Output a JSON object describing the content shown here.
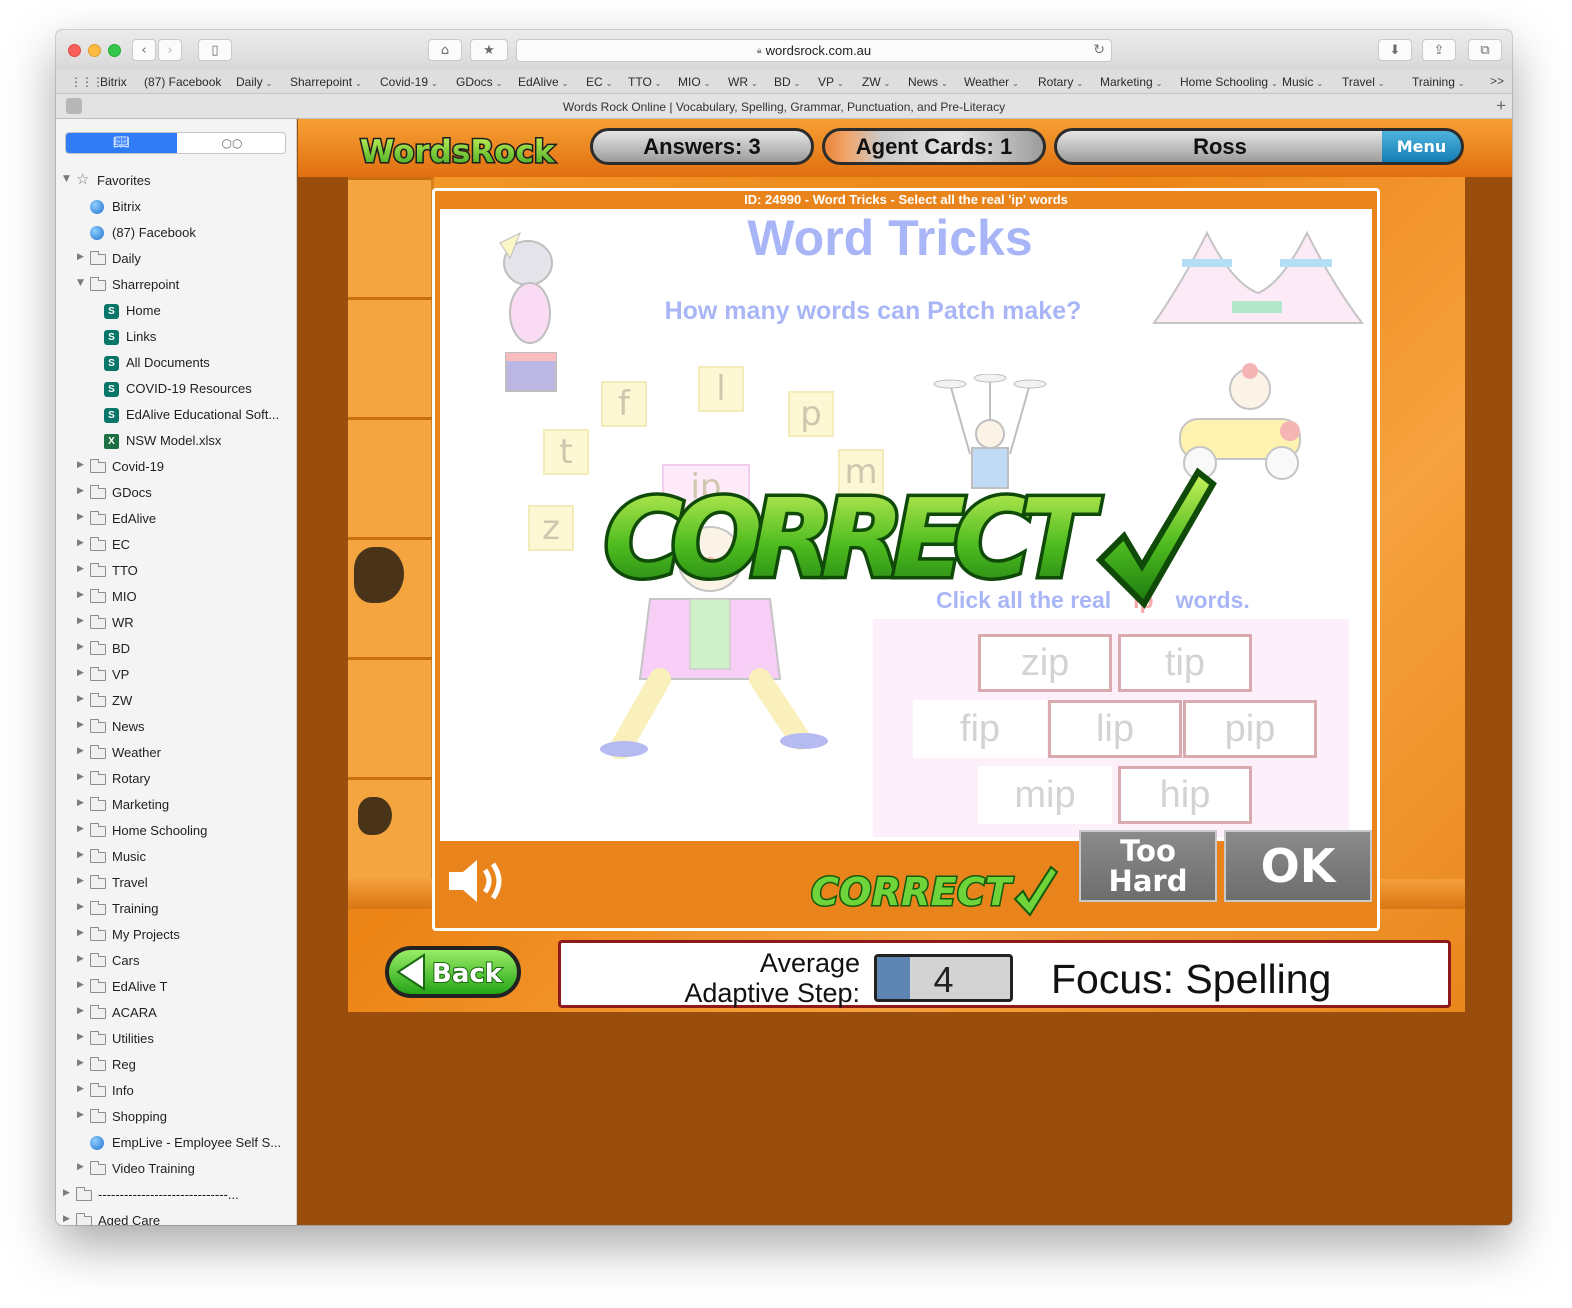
{
  "browser": {
    "url": "wordsrock.com.au",
    "tab_title": "Words Rock Online | Vocabulary, Spelling, Grammar, Punctuation, and Pre-Literacy",
    "favorites_bar": [
      "Bitrix",
      "(87) Facebook",
      "Daily",
      "Sharrepoint",
      "Covid-19",
      "GDocs",
      "EdAlive",
      "EC",
      "TTO",
      "MIO",
      "WR",
      "BD",
      "VP",
      "ZW",
      "News",
      "Weather",
      "Rotary",
      "Marketing",
      "Home Schooling",
      "Music",
      "Travel",
      "Training"
    ],
    "favorites_more": ">>"
  },
  "sidebar": {
    "header": "Favorites",
    "items": [
      {
        "label": "Bitrix",
        "icon": "globe-icon",
        "level": 1
      },
      {
        "label": "(87) Facebook",
        "icon": "globe-icon",
        "level": 1
      },
      {
        "label": "Daily",
        "icon": "folder-icon",
        "level": 1,
        "collapsed": true
      },
      {
        "label": "Sharrepoint",
        "icon": "folder-icon",
        "level": 1,
        "expanded": true
      },
      {
        "label": "Home",
        "icon": "sharepoint-icon",
        "level": 2
      },
      {
        "label": "Links",
        "icon": "sharepoint-icon",
        "level": 2
      },
      {
        "label": "All Documents",
        "icon": "sharepoint-icon",
        "level": 2
      },
      {
        "label": "COVID-19 Resources",
        "icon": "sharepoint-icon",
        "level": 2
      },
      {
        "label": "EdAlive Educational Soft...",
        "icon": "sharepoint-icon",
        "level": 2
      },
      {
        "label": "NSW Model.xlsx",
        "icon": "excel-icon",
        "level": 2
      },
      {
        "label": "Covid-19",
        "icon": "folder-icon",
        "level": 1,
        "collapsed": true
      },
      {
        "label": "GDocs",
        "icon": "folder-icon",
        "level": 1,
        "collapsed": true
      },
      {
        "label": "EdAlive",
        "icon": "folder-icon",
        "level": 1,
        "collapsed": true
      },
      {
        "label": "EC",
        "icon": "folder-icon",
        "level": 1,
        "collapsed": true
      },
      {
        "label": "TTO",
        "icon": "folder-icon",
        "level": 1,
        "collapsed": true
      },
      {
        "label": "MIO",
        "icon": "folder-icon",
        "level": 1,
        "collapsed": true
      },
      {
        "label": "WR",
        "icon": "folder-icon",
        "level": 1,
        "collapsed": true
      },
      {
        "label": "BD",
        "icon": "folder-icon",
        "level": 1,
        "collapsed": true
      },
      {
        "label": "VP",
        "icon": "folder-icon",
        "level": 1,
        "collapsed": true
      },
      {
        "label": "ZW",
        "icon": "folder-icon",
        "level": 1,
        "collapsed": true
      },
      {
        "label": "News",
        "icon": "folder-icon",
        "level": 1,
        "collapsed": true
      },
      {
        "label": "Weather",
        "icon": "folder-icon",
        "level": 1,
        "collapsed": true
      },
      {
        "label": "Rotary",
        "icon": "folder-icon",
        "level": 1,
        "collapsed": true
      },
      {
        "label": "Marketing",
        "icon": "folder-icon",
        "level": 1,
        "collapsed": true
      },
      {
        "label": "Home Schooling",
        "icon": "folder-icon",
        "level": 1,
        "collapsed": true
      },
      {
        "label": "Music",
        "icon": "folder-icon",
        "level": 1,
        "collapsed": true
      },
      {
        "label": "Travel",
        "icon": "folder-icon",
        "level": 1,
        "collapsed": true
      },
      {
        "label": "Training",
        "icon": "folder-icon",
        "level": 1,
        "collapsed": true
      },
      {
        "label": "My Projects",
        "icon": "folder-icon",
        "level": 1,
        "collapsed": true
      },
      {
        "label": "Cars",
        "icon": "folder-icon",
        "level": 1,
        "collapsed": true
      },
      {
        "label": "EdAlive T",
        "icon": "folder-icon",
        "level": 1,
        "collapsed": true
      },
      {
        "label": "ACARA",
        "icon": "folder-icon",
        "level": 1,
        "collapsed": true
      },
      {
        "label": "Utilities",
        "icon": "folder-icon",
        "level": 1,
        "collapsed": true
      },
      {
        "label": "Reg",
        "icon": "folder-icon",
        "level": 1,
        "collapsed": true
      },
      {
        "label": "Info",
        "icon": "folder-icon",
        "level": 1,
        "collapsed": true
      },
      {
        "label": "Shopping",
        "icon": "folder-icon",
        "level": 1,
        "collapsed": true
      },
      {
        "label": "EmpLive - Employee Self S...",
        "icon": "globe-icon",
        "level": 1
      },
      {
        "label": "Video Training",
        "icon": "folder-icon",
        "level": 1,
        "collapsed": true
      },
      {
        "label": "------------------------------...",
        "icon": "folder-icon",
        "level": 0,
        "collapsed": true
      },
      {
        "label": "Aged Care",
        "icon": "folder-icon",
        "level": 0,
        "collapsed": true
      }
    ]
  },
  "game": {
    "logo": "WordsRock",
    "answers": "Answers: 3",
    "agent_cards": "Agent Cards: 1",
    "player": "Ross",
    "menu": "Menu",
    "question_id": "ID: 24990 - Word Tricks - Select all the real 'ip' words",
    "title": "Word Tricks",
    "subtitle": "How many words can Patch make?",
    "letter_tiles": [
      "f",
      "l",
      "p",
      "t",
      "m",
      "z"
    ],
    "juggle_word": "ip",
    "instruction_before": "Click all the real",
    "instruction_target": "ip",
    "instruction_after": "words.",
    "words": [
      {
        "text": "zip",
        "selected": true
      },
      {
        "text": "tip",
        "selected": true
      },
      {
        "text": "fip",
        "selected": false
      },
      {
        "text": "lip",
        "selected": true
      },
      {
        "text": "pip",
        "selected": true
      },
      {
        "text": "mip",
        "selected": false
      },
      {
        "text": "hip",
        "selected": true
      }
    ],
    "result_banner": "CORRECT",
    "result_small": "CORRECT",
    "too_hard_line1": "Too",
    "too_hard_line2": "Hard",
    "ok": "OK",
    "back": "Back",
    "avg_label_line1": "Average",
    "avg_label_line2": "Adaptive Step:",
    "adaptive_step": "4",
    "adaptive_step_fill_fraction": 0.25,
    "focus": "Focus: Spelling"
  }
}
